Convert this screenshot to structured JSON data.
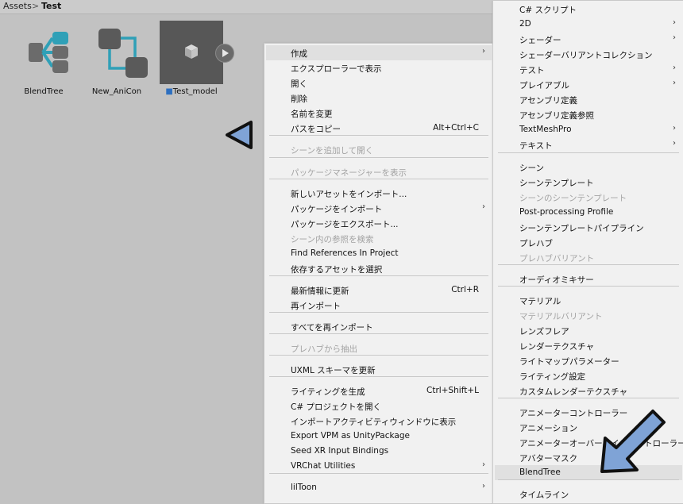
{
  "breadcrumb": {
    "root": "Assets",
    "separator": ">",
    "current": "Test"
  },
  "assets": [
    {
      "name": "BlendTree",
      "icon": "blendtree-icon"
    },
    {
      "name": "New_AniCon",
      "icon": "animator-controller-icon"
    },
    {
      "name": "Test_model",
      "icon": "model-prefab-icon",
      "selected": true
    }
  ],
  "colors": {
    "blendtree": "#6b6b6b",
    "blendtree_accent": "#2fa0b7",
    "animator": "#5a5a5a",
    "animator_link": "#2fa0b7",
    "highlight": "#e0e0e0",
    "arrow_fill": "#7fa3d6"
  },
  "context_menu": {
    "items": [
      {
        "label": "作成",
        "submenu": true,
        "highlighted": true
      },
      {
        "label": "エクスプローラーで表示"
      },
      {
        "label": "開く"
      },
      {
        "label": "削除"
      },
      {
        "label": "名前を変更"
      },
      {
        "label": "パスをコピー",
        "shortcut": "Alt+Ctrl+C"
      },
      {
        "label": "シーンを追加して開く",
        "disabled": true
      },
      {
        "label": "パッケージマネージャーを表示",
        "disabled": true
      },
      {
        "label": "新しいアセットをインポート..."
      },
      {
        "label": "パッケージをインポート",
        "submenu": true
      },
      {
        "label": "パッケージをエクスポート..."
      },
      {
        "label": "シーン内の参照を検索",
        "disabled": true
      },
      {
        "label": "Find References In Project"
      },
      {
        "label": "依存するアセットを選択"
      },
      {
        "label": "最新情報に更新",
        "shortcut": "Ctrl+R"
      },
      {
        "label": "再インポート"
      },
      {
        "label": "すべてを再インポート"
      },
      {
        "label": "プレハブから抽出",
        "disabled": true
      },
      {
        "label": "UXML スキーマを更新"
      },
      {
        "label": "ライティングを生成",
        "shortcut": "Ctrl+Shift+L"
      },
      {
        "label": "C# プロジェクトを開く"
      },
      {
        "label": "インポートアクティビティウィンドウに表示"
      },
      {
        "label": "Export VPM as UnityPackage"
      },
      {
        "label": "Seed XR Input Bindings"
      },
      {
        "label": "VRChat Utilities",
        "submenu": true
      },
      {
        "label": "lilToon",
        "submenu": true
      }
    ]
  },
  "create_submenu": {
    "items": [
      {
        "label": "C# スクリプト"
      },
      {
        "label": "2D",
        "submenu": true
      },
      {
        "label": "シェーダー",
        "submenu": true
      },
      {
        "label": "シェーダーバリアントコレクション"
      },
      {
        "label": "テスト",
        "submenu": true
      },
      {
        "label": "プレイアブル",
        "submenu": true
      },
      {
        "label": "アセンブリ定義"
      },
      {
        "label": "アセンブリ定義参照"
      },
      {
        "label": "TextMeshPro",
        "submenu": true
      },
      {
        "label": "テキスト",
        "submenu": true
      },
      {
        "label": "シーン"
      },
      {
        "label": "シーンテンプレート"
      },
      {
        "label": "シーンのシーンテンプレート",
        "disabled": true
      },
      {
        "label": "Post-processing Profile"
      },
      {
        "label": "シーンテンプレートパイプライン"
      },
      {
        "label": "プレハブ"
      },
      {
        "label": "プレハブバリアント",
        "disabled": true
      },
      {
        "label": "オーディオミキサー"
      },
      {
        "label": "マテリアル"
      },
      {
        "label": "マテリアルバリアント",
        "disabled": true
      },
      {
        "label": "レンズフレア"
      },
      {
        "label": "レンダーテクスチャ"
      },
      {
        "label": "ライトマップパラメーター"
      },
      {
        "label": "ライティング設定"
      },
      {
        "label": "カスタムレンダーテクスチャ"
      },
      {
        "label": "アニメーターコントローラー"
      },
      {
        "label": "アニメーション"
      },
      {
        "label": "アニメーターオーバーライドコントローラー"
      },
      {
        "label": "アバターマスク"
      },
      {
        "label": "BlendTree",
        "highlighted": true
      },
      {
        "label": "タイムライン"
      }
    ]
  },
  "annotations": [
    {
      "name": "left-pointing-arrow",
      "icon": "triangle-arrow-icon"
    },
    {
      "name": "down-left-arrow",
      "icon": "pointer-arrow-icon"
    }
  ]
}
